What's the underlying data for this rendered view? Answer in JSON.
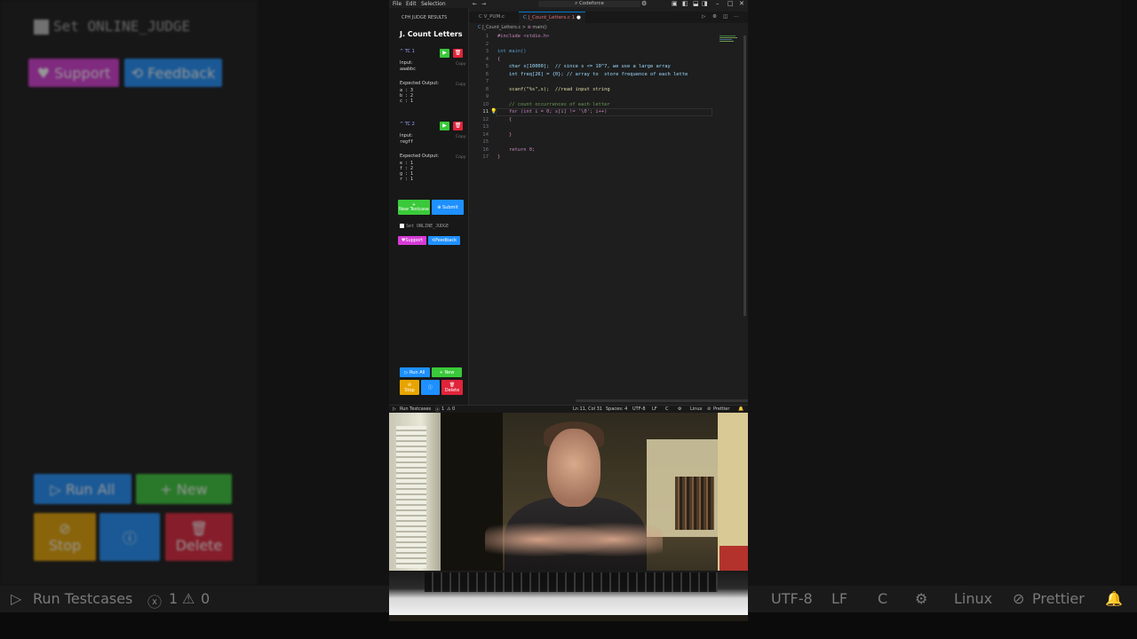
{
  "background_ghost": {
    "set_online_judge": "Set ONLINE_JUDGE",
    "support_label": "Support",
    "feedback_label": "Feedback",
    "run_all_label": "Run All",
    "new_label": "New",
    "stop_label": "Stop",
    "delete_label": "Delete",
    "status": {
      "run_testcases": "Run Testcases",
      "errors": "1",
      "warnings": "0",
      "encoding": "UTF-8",
      "eol": "LF",
      "language": "C",
      "os": "Linux",
      "formatter": "Prettier"
    }
  },
  "titlebar": {
    "menu": [
      "File",
      "Edit",
      "Selection"
    ],
    "search_text": "Codeforce"
  },
  "cph": {
    "header": "CPH JUDGE RESULTS",
    "problem_title": "J. Count Letters",
    "testcases": [
      {
        "label": "TC 1",
        "input_label": "Input:",
        "input": "aaabbc",
        "expected_label": "Expected Output:",
        "expected": [
          "a : 3",
          "b : 2",
          "c : 1"
        ],
        "copy_label": "Copy"
      },
      {
        "label": "TC 2",
        "input_label": "Input:",
        "input": "regff",
        "expected_label": "Expected Output:",
        "expected": [
          "e : 1",
          "f : 2",
          "g : 1",
          "r : 1"
        ],
        "copy_label": "Copy"
      }
    ],
    "new_testcase_label": "New Testcase",
    "submit_label": "Submit",
    "set_online_judge": "Set ONLINE_JUDGE",
    "support_label": "Support",
    "feedback_label": "Feedback",
    "run_all_label": "Run All",
    "new_label": "New",
    "stop_label": "Stop",
    "delete_label": "Delete"
  },
  "tabs": [
    {
      "label": "V_PUM.c",
      "active": false
    },
    {
      "label": "J_Count_Letters.c",
      "active": true,
      "badge": "1"
    }
  ],
  "breadcrumb": {
    "file": "J_Count_Letters.c",
    "symbol": "main()"
  },
  "code_lines": [
    {
      "n": "1",
      "text": "#include <stdio.h>"
    },
    {
      "n": "2",
      "text": ""
    },
    {
      "n": "3",
      "text": "int main()"
    },
    {
      "n": "4",
      "text": "{"
    },
    {
      "n": "5",
      "text": "    char s[10000];  // since s <= 10^7, we use a large array"
    },
    {
      "n": "6",
      "text": "    int freq[26] = {0}; // array to  store frequence of each lette"
    },
    {
      "n": "7",
      "text": ""
    },
    {
      "n": "8",
      "text": "    scanf(\"%s\",s);  //read input string"
    },
    {
      "n": "9",
      "text": ""
    },
    {
      "n": "10",
      "text": "    // count occurrences of each letter"
    },
    {
      "n": "11",
      "text": "    for (int i = 0; s[i] != '\\0'; i++)"
    },
    {
      "n": "12",
      "text": "    {"
    },
    {
      "n": "13",
      "text": ""
    },
    {
      "n": "14",
      "text": "    }"
    },
    {
      "n": "15",
      "text": ""
    },
    {
      "n": "16",
      "text": "    return 0;"
    },
    {
      "n": "17",
      "text": "}"
    }
  ],
  "statusbar": {
    "run_testcases": "Run Testcases",
    "problems": "1",
    "warnings": "0",
    "position": "Ln 11, Col 31",
    "spaces": "Spaces: 4",
    "encoding": "UTF-8",
    "eol": "LF",
    "language": "C",
    "os": "Linux",
    "formatter": "Prettier"
  },
  "colors": {
    "run_green": "#3ac93a",
    "delete_red": "#e0243a",
    "submit_blue": "#1e90ff",
    "support_magenta": "#d63bd6",
    "stop_orange": "#e8a400",
    "editor_bg": "#1e1e1e"
  }
}
